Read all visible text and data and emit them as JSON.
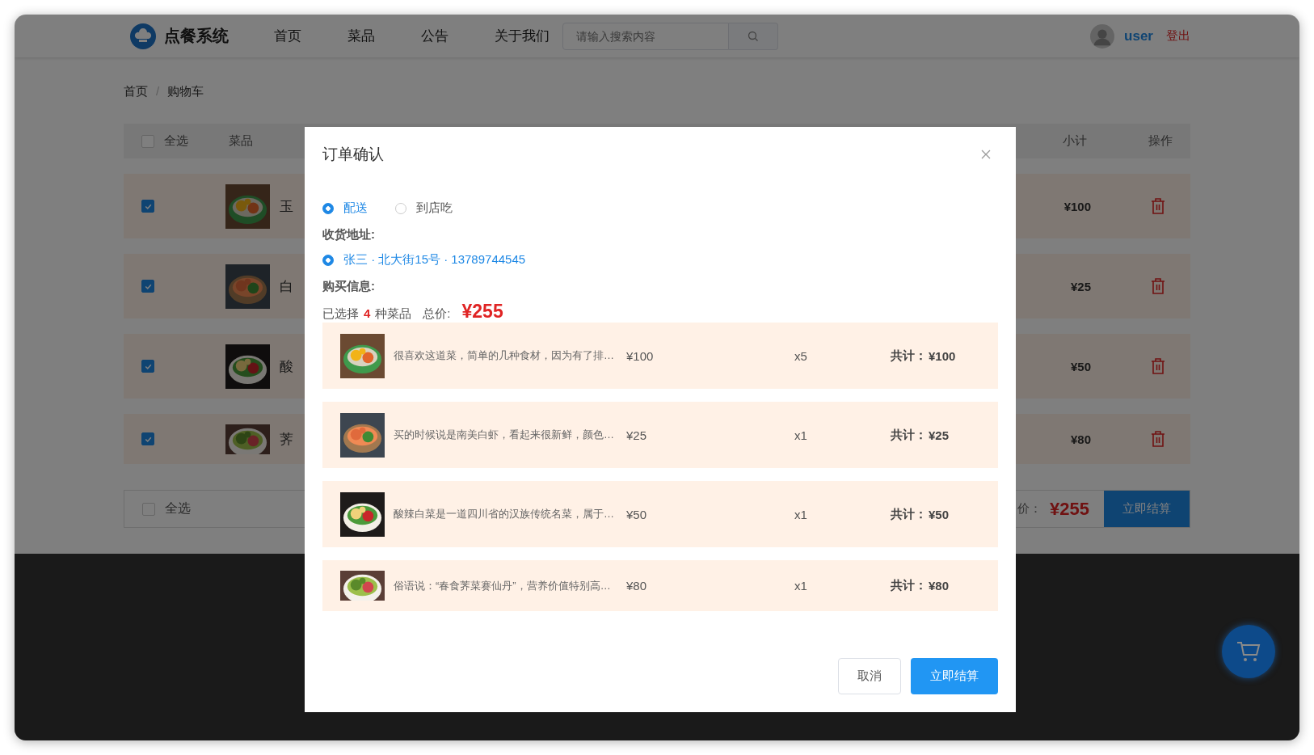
{
  "header": {
    "logo_text": "点餐系统",
    "nav": [
      {
        "label": "首页"
      },
      {
        "label": "菜品"
      },
      {
        "label": "公告"
      },
      {
        "label": "关于我们"
      }
    ],
    "search": {
      "placeholder": "请输入搜索内容"
    },
    "user": {
      "name": "user",
      "logout": "登出"
    }
  },
  "breadcrumb": {
    "separator": "/",
    "items": [
      "首页",
      "购物车"
    ]
  },
  "cart": {
    "select_all_checked": false,
    "columns": [
      "全选",
      "菜品",
      "小计",
      "操作"
    ],
    "rows": [
      {
        "checked": true,
        "name": "玉",
        "subtotal": "¥100"
      },
      {
        "checked": true,
        "name": "白",
        "subtotal": "¥25"
      },
      {
        "checked": true,
        "name": "酸",
        "subtotal": "¥50"
      },
      {
        "checked": true,
        "name": "荠",
        "subtotal": "¥80"
      }
    ],
    "footer": {
      "select_all": {
        "label": "全选",
        "checked": false
      },
      "total_label": "价：",
      "total": "¥255",
      "checkout": "立即结算"
    }
  },
  "dialog": {
    "title": "订单确认",
    "delivery": [
      {
        "label": "配送",
        "selected": true
      },
      {
        "label": "到店吃",
        "selected": false
      }
    ],
    "address_label": "收货地址:",
    "addresses": [
      {
        "text": "张三 · 北大街15号 · 13789744545",
        "selected": true
      }
    ],
    "purchase_label": "购买信息:",
    "summary": {
      "prefix": "已选择",
      "count": "4",
      "suffix": "种菜品",
      "total_label": "总价:",
      "total": "¥255"
    },
    "items": [
      {
        "desc": "很喜欢这道菜，简单的几种食材，因为有了排…",
        "price": "¥100",
        "qty": "x5",
        "total_label": "共计：",
        "total": "¥100"
      },
      {
        "desc": "买的时候说是南美白虾，看起来很新鲜，颜色…",
        "price": "¥25",
        "qty": "x1",
        "total_label": "共计：",
        "total": "¥25"
      },
      {
        "desc": "酸辣白菜是一道四川省的汉族传统名菜，属于…",
        "price": "¥50",
        "qty": "x1",
        "total_label": "共计：",
        "total": "¥50"
      },
      {
        "desc": "俗语说：“春食荠菜赛仙丹”，营养价值特别高…",
        "price": "¥80",
        "qty": "x1",
        "total_label": "共计：",
        "total": "¥80"
      }
    ],
    "buttons": {
      "cancel": "取消",
      "confirm": "立即结算"
    }
  }
}
